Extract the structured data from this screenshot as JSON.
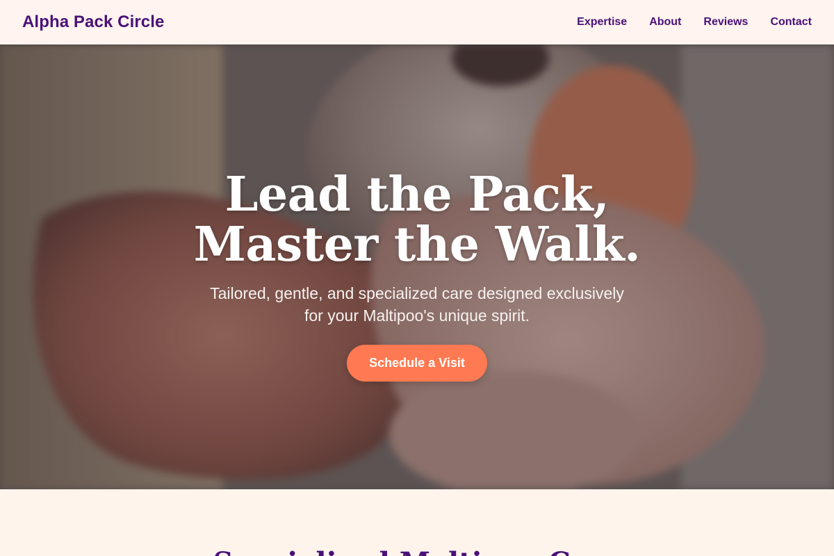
{
  "header": {
    "brand": "Alpha Pack Circle",
    "nav": [
      "Expertise",
      "About",
      "Reviews",
      "Contact"
    ]
  },
  "hero": {
    "title_line1": "Lead the Pack,",
    "title_line2": "Master the Walk.",
    "subtitle_line1": "Tailored, gentle, and specialized care designed exclusively",
    "subtitle_line2": "for your Maltipoo's unique spirit.",
    "cta_label": "Schedule a Visit"
  },
  "section": {
    "title": "Specialized Maltipoo Care"
  },
  "colors": {
    "brand": "#4a1078",
    "accent": "#ff7a52",
    "page_background": "#fff4ec"
  }
}
